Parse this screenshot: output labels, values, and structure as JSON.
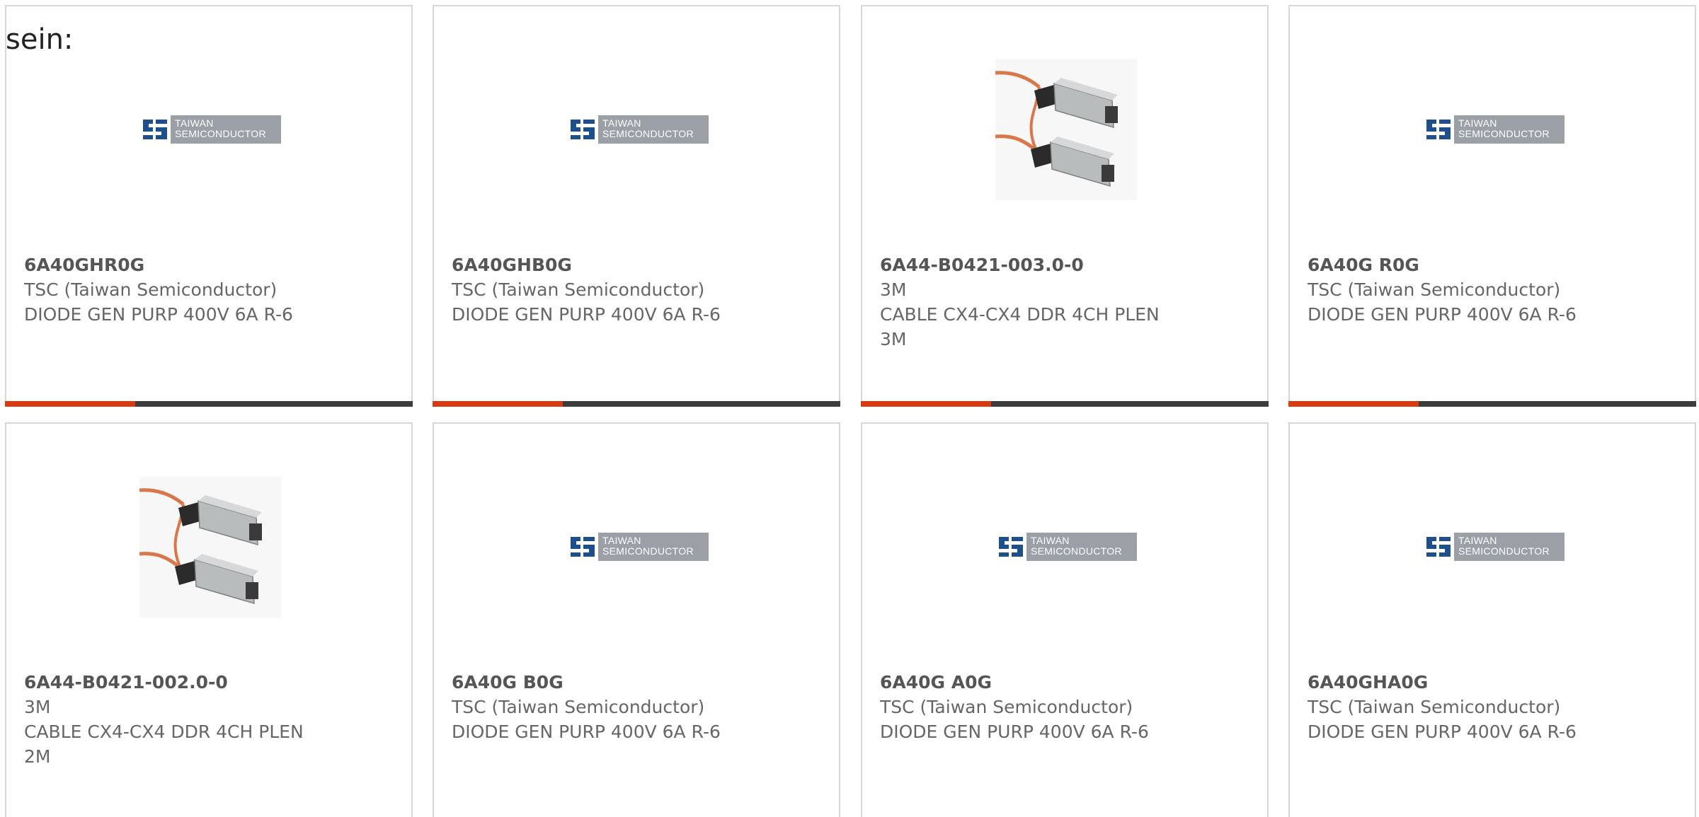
{
  "intro_text": "sein:",
  "colors": {
    "card_border": "#d7d7d7",
    "bar_dark": "#3c3c3c",
    "bar_accent": "#d93a12",
    "text": "#666666",
    "logo_blue": "#1c4f8c",
    "logo_gray": "#9aa0a6"
  },
  "tsc_logo": {
    "line1": "TAIWAN",
    "line2": "SEMICONDUCTOR"
  },
  "products": [
    {
      "part_number": "6A40GHR0G",
      "manufacturer": "TSC (Taiwan Semiconductor)",
      "description": "DIODE GEN PURP 400V 6A R-6",
      "image": "tsc-logo"
    },
    {
      "part_number": "6A40GHB0G",
      "manufacturer": "TSC (Taiwan Semiconductor)",
      "description": "DIODE GEN PURP 400V 6A R-6",
      "image": "tsc-logo"
    },
    {
      "part_number": "6A44-B0421-003.0-0",
      "manufacturer": "3M",
      "description": "CABLE CX4-CX4 DDR 4CH PLEN",
      "description_line2": "3M",
      "image": "cable-photo"
    },
    {
      "part_number": "6A40G R0G",
      "manufacturer": "TSC (Taiwan Semiconductor)",
      "description": "DIODE GEN PURP 400V 6A R-6",
      "image": "tsc-logo"
    },
    {
      "part_number": "6A44-B0421-002.0-0",
      "manufacturer": "3M",
      "description": "CABLE CX4-CX4 DDR 4CH PLEN",
      "description_line2": "2M",
      "image": "cable-photo"
    },
    {
      "part_number": "6A40G B0G",
      "manufacturer": "TSC (Taiwan Semiconductor)",
      "description": "DIODE GEN PURP 400V 6A R-6",
      "image": "tsc-logo"
    },
    {
      "part_number": "6A40G A0G",
      "manufacturer": "TSC (Taiwan Semiconductor)",
      "description": "DIODE GEN PURP 400V 6A R-6",
      "image": "tsc-logo"
    },
    {
      "part_number": "6A40GHA0G",
      "manufacturer": "TSC (Taiwan Semiconductor)",
      "description": "DIODE GEN PURP 400V 6A R-6",
      "image": "tsc-logo"
    }
  ]
}
